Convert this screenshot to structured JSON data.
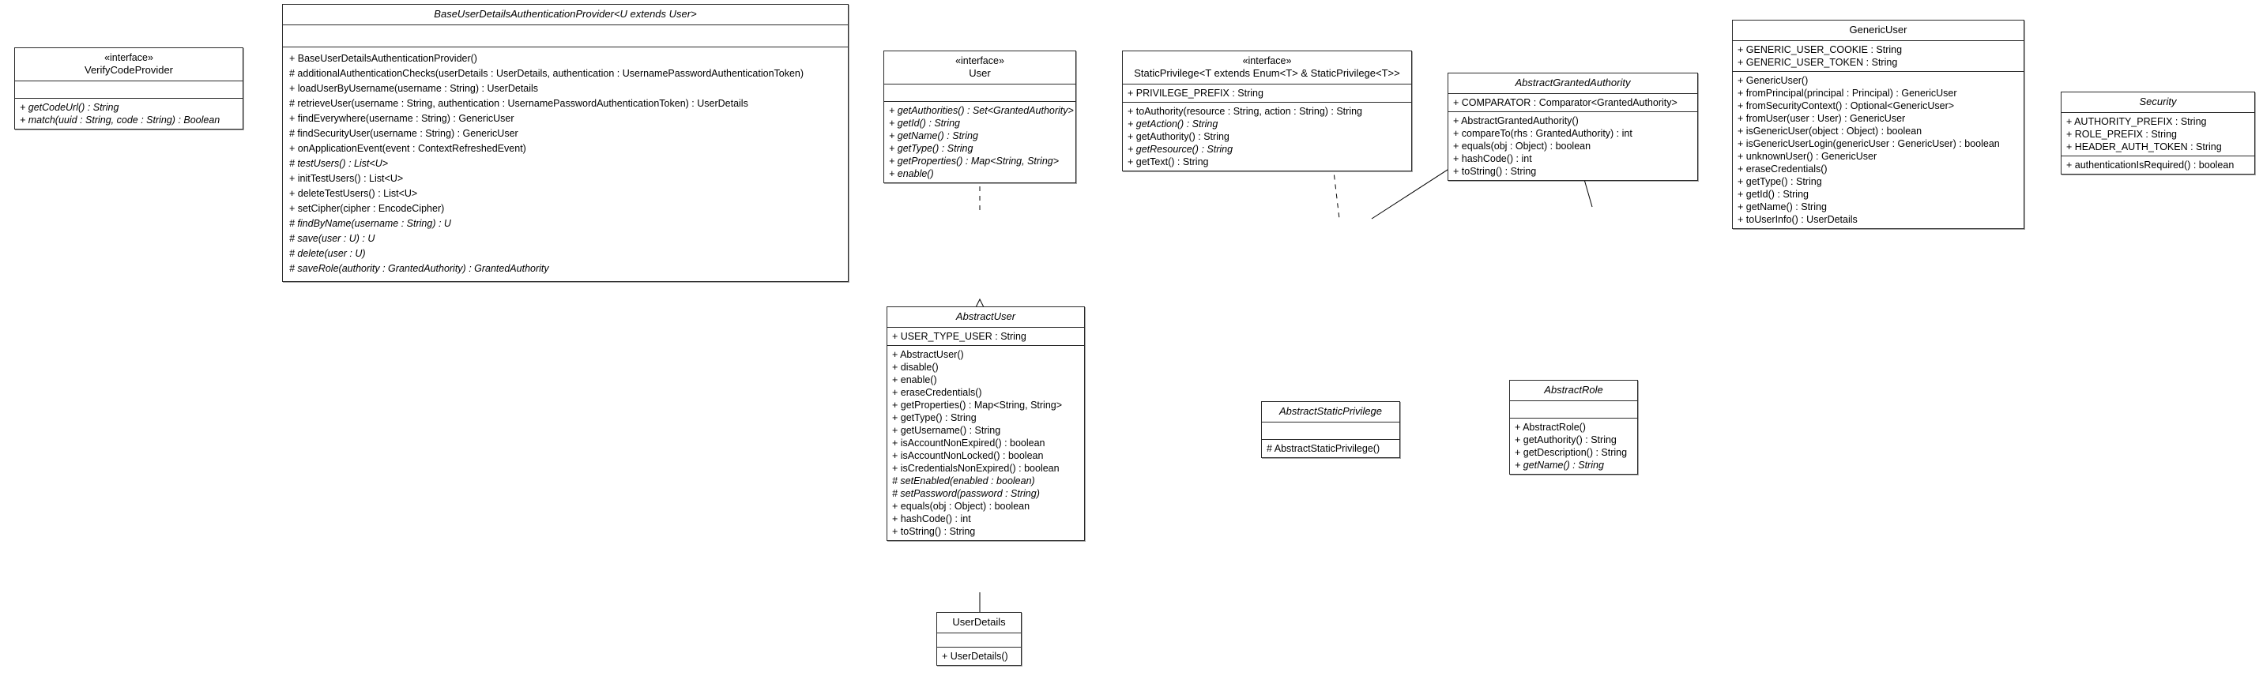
{
  "diagram": {
    "title": "UML class diagram",
    "type": "uml-class-diagram",
    "stereotype_interface": "«interface»"
  },
  "classes": {
    "verify_code_provider": {
      "stereotype": "«interface»",
      "name": "VerifyCodeProvider",
      "attributes": [],
      "operations": [
        "+ getCodeUrl() : String",
        "+ match(uuid : String, code : String) : Boolean"
      ]
    },
    "base_provider": {
      "stereotype": "",
      "name": "BaseUserDetailsAuthenticationProvider<U extends User>",
      "attributes": [],
      "operations": [
        "+ BaseUserDetailsAuthenticationProvider()",
        "# additionalAuthenticationChecks(userDetails : UserDetails, authentication : UsernamePasswordAuthenticationToken)",
        "+ loadUserByUsername(username : String) : UserDetails",
        "# retrieveUser(username : String, authentication : UsernamePasswordAuthenticationToken) : UserDetails",
        "+ findEverywhere(username : String) : GenericUser",
        "# findSecurityUser(username : String) : GenericUser",
        "+ onApplicationEvent(event : ContextRefreshedEvent)",
        "# testUsers() : List<U>",
        "+ initTestUsers() : List<U>",
        "+ deleteTestUsers() : List<U>",
        "+ setCipher(cipher : EncodeCipher)",
        "# findByName(username : String) : U",
        "# save(user : U) : U",
        "# delete(user : U)",
        "# saveRole(authority : GrantedAuthority) : GrantedAuthority"
      ],
      "italic_operations": [
        7,
        11,
        12,
        13,
        14
      ]
    },
    "user": {
      "stereotype": "«interface»",
      "name": "User",
      "attributes": [],
      "operations": [
        "+ getAuthorities() : Set<GrantedAuthority>",
        "+ getId() : String",
        "+ getName() : String",
        "+ getType() : String",
        "+ getProperties() : Map<String, String>",
        "+ enable()"
      ],
      "italic_operations": [
        0,
        1,
        2,
        3,
        4,
        5
      ]
    },
    "static_privilege": {
      "stereotype": "«interface»",
      "name": "StaticPrivilege<T extends Enum<T> & StaticPrivilege<T>>",
      "attributes": [
        "+ PRIVILEGE_PREFIX : String"
      ],
      "operations": [
        "+ toAuthority(resource : String, action : String) : String",
        "+ getAction() : String",
        "+ getAuthority() : String",
        "+ getResource() : String",
        "+ getText() : String"
      ],
      "italic_operations": [
        1,
        3
      ]
    },
    "abstract_granted_authority": {
      "stereotype": "",
      "name": "AbstractGrantedAuthority",
      "attributes": [
        "+ COMPARATOR : Comparator<GrantedAuthority>"
      ],
      "operations": [
        "+ AbstractGrantedAuthority()",
        "+ compareTo(rhs : GrantedAuthority) : int",
        "+ equals(obj : Object) : boolean",
        "+ hashCode() : int",
        "+ toString() : String"
      ],
      "italic_operations": []
    },
    "generic_user": {
      "stereotype": "",
      "name": "GenericUser",
      "attributes": [
        "+ GENERIC_USER_COOKIE : String",
        "+ GENERIC_USER_TOKEN : String"
      ],
      "operations": [
        "+ GenericUser()",
        "+ fromPrincipal(principal : Principal) : GenericUser",
        "+ fromSecurityContext() : Optional<GenericUser>",
        "+ fromUser(user : User) : GenericUser",
        "+ isGenericUser(object : Object) : boolean",
        "+ isGenericUserLogin(genericUser : GenericUser) : boolean",
        "+ unknownUser() : GenericUser",
        "+ eraseCredentials()",
        "+ getType() : String",
        "+ getId() : String",
        "+ getName() : String",
        "+ toUserInfo() : UserDetails"
      ],
      "italic_operations": []
    },
    "security": {
      "stereotype": "",
      "name": "Security",
      "attributes": [
        "+ AUTHORITY_PREFIX : String",
        "+ ROLE_PREFIX : String",
        "+ HEADER_AUTH_TOKEN : String"
      ],
      "operations": [
        "+ authenticationIsRequired() : boolean"
      ],
      "italic_operations": []
    },
    "abstract_user": {
      "stereotype": "",
      "name": "AbstractUser",
      "attributes": [
        "+ USER_TYPE_USER : String"
      ],
      "operations": [
        "+ AbstractUser()",
        "+ disable()",
        "+ enable()",
        "+ eraseCredentials()",
        "+ getProperties() : Map<String, String>",
        "+ getType() : String",
        "+ getUsername() : String",
        "+ isAccountNonExpired() : boolean",
        "+ isAccountNonLocked() : boolean",
        "+ isCredentialsNonExpired() : boolean",
        "# setEnabled(enabled : boolean)",
        "# setPassword(password : String)",
        "+ equals(obj : Object) : boolean",
        "+ hashCode() : int",
        "+ toString() : String"
      ],
      "italic_operations": [
        10,
        11
      ]
    },
    "abstract_static_privilege": {
      "stereotype": "",
      "name": "AbstractStaticPrivilege",
      "attributes": [],
      "operations": [
        "# AbstractStaticPrivilege()"
      ],
      "italic_operations": []
    },
    "abstract_role": {
      "stereotype": "",
      "name": "AbstractRole",
      "attributes": [],
      "operations": [
        "+ AbstractRole()",
        "+ getAuthority() : String",
        "+ getDescription() : String",
        "+ getName() : String"
      ],
      "italic_operations": [
        3
      ]
    },
    "user_details": {
      "stereotype": "",
      "name": "UserDetails",
      "attributes": [],
      "operations": [
        "+ UserDetails()"
      ],
      "italic_operations": []
    }
  },
  "relationships": [
    {
      "from": "abstract_user",
      "to": "user",
      "kind": "realization"
    },
    {
      "from": "user_details",
      "to": "abstract_user",
      "kind": "generalization"
    },
    {
      "from": "abstract_static_privilege",
      "to": "static_privilege",
      "kind": "realization"
    },
    {
      "from": "abstract_static_privilege",
      "to": "abstract_granted_authority",
      "kind": "generalization"
    },
    {
      "from": "abstract_role",
      "to": "abstract_granted_authority",
      "kind": "generalization"
    }
  ]
}
